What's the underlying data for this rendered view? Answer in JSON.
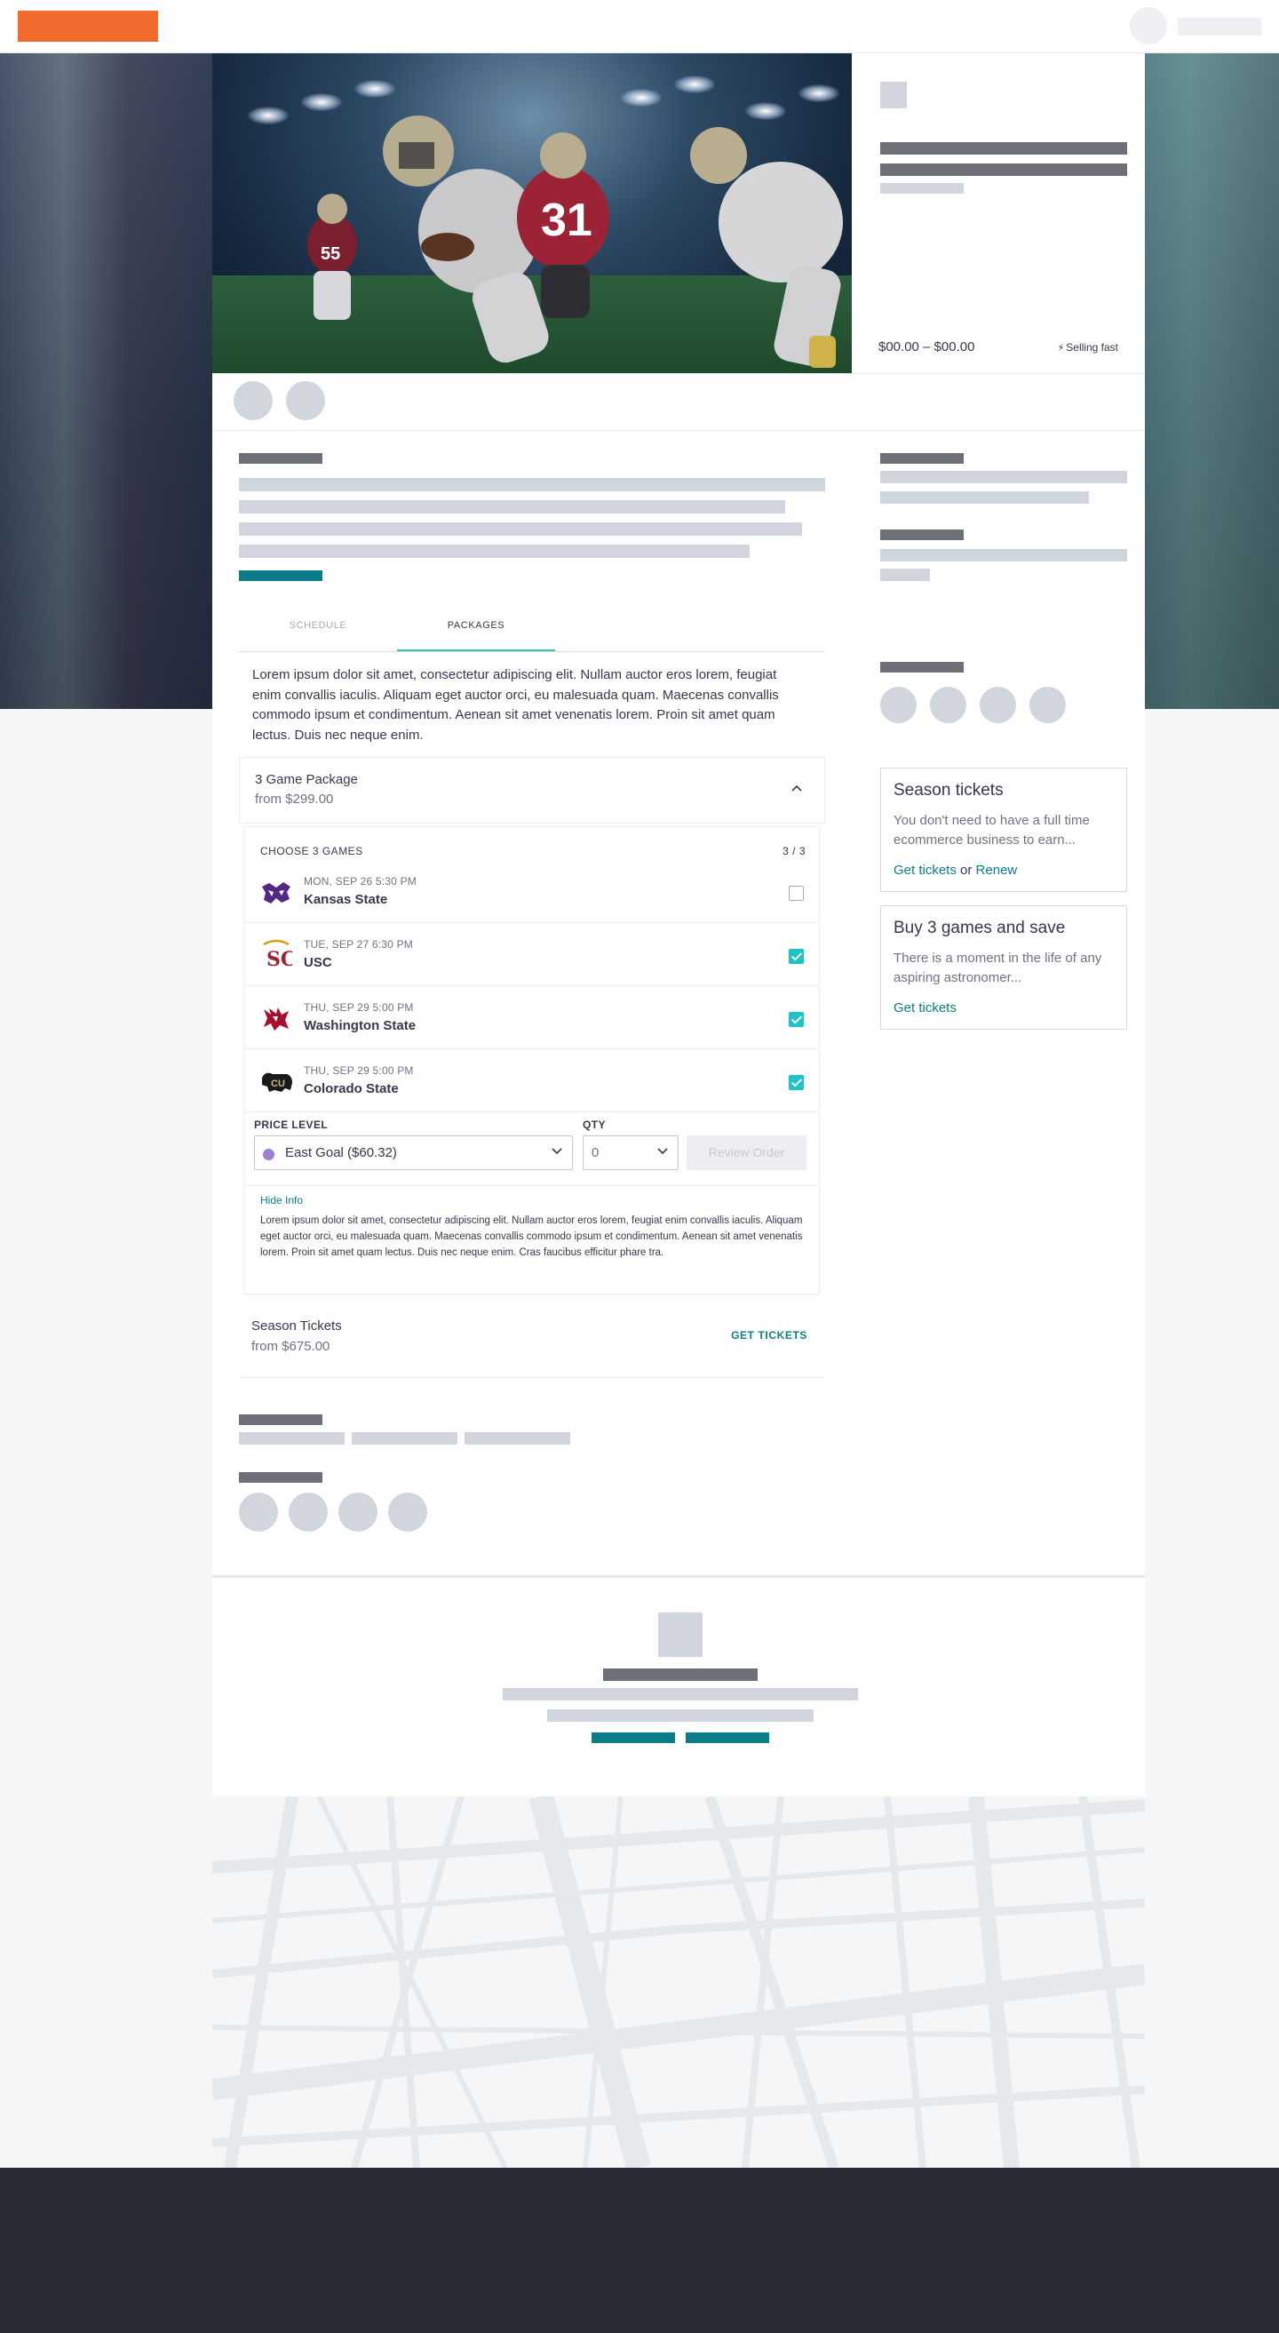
{
  "colors": {
    "brand": "#f26b2c",
    "accent": "#1fc2c6",
    "link": "#0b7d8a",
    "text": "#39364f",
    "footer": "#262a33",
    "price_level_dot": "#9b7fd4"
  },
  "hero": {
    "price_range": "$00.00 – $00.00",
    "selling_fast": "Selling fast",
    "selling_fast_icon": "lightning-icon"
  },
  "tabs": [
    {
      "label": "SCHEDULE",
      "active": false
    },
    {
      "label": "PACKAGES",
      "active": true
    }
  ],
  "intro": "Lorem ipsum dolor sit amet, consectetur adipiscing elit. Nullam auctor eros lorem, feugiat enim convallis iaculis. Aliquam eget auctor orci, eu malesuada quam. Maecenas convallis commodo ipsum et condimentum. Aenean sit amet venenatis lorem. Proin sit amet quam lectus. Duis nec neque enim.",
  "package": {
    "title": "3 Game Package",
    "from": "from $299.00",
    "choose_label": "CHOOSE 3 GAMES",
    "choose_count": "3 / 3",
    "games": [
      {
        "date": "MON, SEP 26 5:30 PM",
        "name": "Kansas State",
        "selected": false,
        "logo": "kansas-state-wildcat-logo"
      },
      {
        "date": "TUE, SEP 27 6:30 PM",
        "name": "USC",
        "selected": true,
        "logo": "usc-trojans-logo"
      },
      {
        "date": "THU, SEP 29 5:00 PM",
        "name": "Washington State",
        "selected": true,
        "logo": "washington-state-cougar-logo"
      },
      {
        "date": "THU, SEP 29 5:00 PM",
        "name": "Colorado State",
        "selected": true,
        "logo": "colorado-buffalo-logo"
      }
    ],
    "price_level_label": "PRICE LEVEL",
    "price_level_value": "East Goal ($60.32)",
    "qty_label": "QTY",
    "qty_value": "0",
    "review_button": "Review Order",
    "hide_info": "Hide Info",
    "info_text": "Lorem ipsum dolor sit amet, consectetur adipiscing elit. Nullam auctor eros lorem,  feugiat enim convallis iaculis. Aliquam eget auctor orci, eu malesuada quam. Maecenas convallis commodo ipsum et condimentum. Aenean sit amet venenatis lorem. Proin sit amet quam lectus. Duis nec neque enim. Cras faucibus efficitur phare tra."
  },
  "season_row": {
    "title": "Season Tickets",
    "from": "from $675.00",
    "cta": "GET TICKETS"
  },
  "cards": [
    {
      "title": "Season tickets",
      "desc": "You don't need to have a full time ecommerce business to earn...",
      "link1": "Get tickets",
      "separator": "or",
      "link2": "Renew"
    },
    {
      "title": "Buy 3 games and save",
      "desc": "There is a moment in the life of any aspiring astronomer...",
      "link1": "Get tickets"
    }
  ]
}
